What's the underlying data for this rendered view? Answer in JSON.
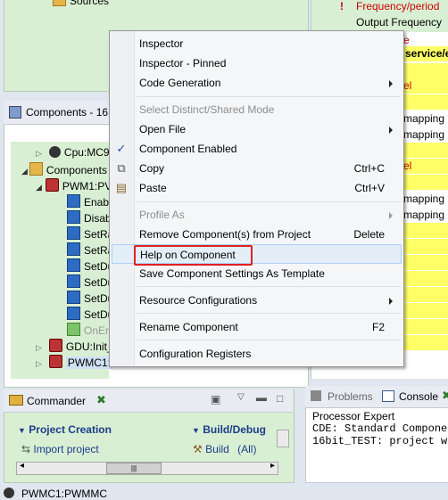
{
  "background": {
    "top_left_item": "Sources",
    "right_panel": {
      "frequency_label": "Frequency/period",
      "output_frequency_label": "Output Frequency",
      "yellow_text": "service/e",
      "fragment_mapping": "mapping",
      "fragment_el": "el",
      "fragment_e": "e"
    },
    "components_view": {
      "tab_title": "Components - 16",
      "tree": [
        {
          "label": "Cpu:MC9",
          "level": 1
        },
        {
          "label": "Components",
          "level": 0
        },
        {
          "label": "PWM1:PV",
          "level": 1
        },
        {
          "label": "Enabl",
          "level": 2
        },
        {
          "label": "Disab",
          "level": 2
        },
        {
          "label": "SetRa",
          "level": 2
        },
        {
          "label": "SetRa",
          "level": 2
        },
        {
          "label": "SetDu",
          "level": 2
        },
        {
          "label": "SetDu",
          "level": 2
        },
        {
          "label": "SetDu",
          "level": 2
        },
        {
          "label": "SetDu",
          "level": 2
        },
        {
          "label": "OnEn",
          "level": 2
        },
        {
          "label": "GDU:Init_",
          "level": 1
        },
        {
          "label": "PWMC1:",
          "level": 1
        }
      ]
    },
    "commander": {
      "tab_title": "Commander",
      "project_creation": "Project Creation",
      "import_project": "Import project",
      "build_debug": "Build/Debug",
      "build": "Build",
      "build_all": "(All)"
    },
    "console": {
      "tab_problems": "Problems",
      "tab_console": "Console",
      "header": "Processor Expert",
      "lines": [
        "CDE: Standard Componen",
        "16bit_TEST: project wa"
      ]
    },
    "status_bar": "PWMC1:PWMMC"
  },
  "context_menu": {
    "items": [
      {
        "label": "Inspector",
        "enabled": true
      },
      {
        "label": "Inspector - Pinned",
        "enabled": true
      },
      {
        "label": "Code Generation",
        "enabled": true,
        "submenu": true
      },
      {
        "separator": true
      },
      {
        "label": "Select Distinct/Shared Mode",
        "enabled": false
      },
      {
        "label": "Open File",
        "enabled": true,
        "submenu": true
      },
      {
        "label": "Component Enabled",
        "enabled": true,
        "checked": true
      },
      {
        "label": "Copy",
        "enabled": true,
        "accel": "Ctrl+C",
        "icon": "copy-icon"
      },
      {
        "label": "Paste",
        "enabled": true,
        "accel": "Ctrl+V",
        "icon": "paste-icon"
      },
      {
        "separator": true
      },
      {
        "label": "Profile As",
        "enabled": false,
        "submenu": true
      },
      {
        "label": "Remove Component(s) from Project",
        "enabled": true,
        "accel": "Delete"
      },
      {
        "label": "Help on Component",
        "enabled": true,
        "hovered": true,
        "highlighted": true
      },
      {
        "label": "Save Component Settings As Template",
        "enabled": true
      },
      {
        "separator": true
      },
      {
        "label": "Resource Configurations",
        "enabled": true,
        "submenu": true
      },
      {
        "separator": true
      },
      {
        "label": "Rename Component",
        "enabled": true,
        "accel": "F2"
      },
      {
        "separator": true
      },
      {
        "label": "Configuration Registers",
        "enabled": true
      }
    ]
  },
  "colors": {
    "highlight_border": "#e02020",
    "view_green": "#d9efd3",
    "yellow_cell": "#ffff66",
    "red_text": "#cc0000"
  }
}
